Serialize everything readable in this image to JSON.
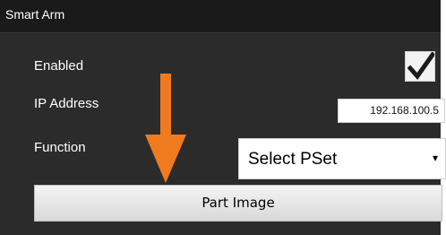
{
  "panel": {
    "title": "Smart Arm"
  },
  "fields": {
    "enabled_label": "Enabled",
    "enabled_checked": true,
    "ip_label": "IP Address",
    "ip_value": "192.168.100.5",
    "function_label": "Function",
    "function_selected": "Select PSet"
  },
  "buttons": {
    "part_image_label": "Part Image"
  },
  "icons": {
    "checkbox": "checkmark-icon",
    "select_arrow": "dropdown-arrow-icon",
    "annotation": "orange-down-arrow"
  },
  "colors": {
    "panel_bg": "#2b2b2b",
    "annotation_arrow": "#f07a1e"
  }
}
